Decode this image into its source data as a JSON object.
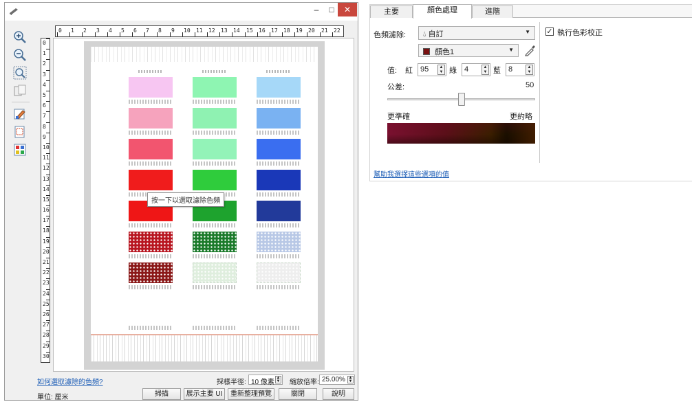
{
  "window": {
    "minimize_glyph": "–",
    "maximize_glyph": "□",
    "close_glyph": "✕"
  },
  "toolbar": {
    "icons": [
      "zoom-in-icon",
      "zoom-out-icon",
      "zoom-fit-icon",
      "page-fit-icon",
      "color-pick-icon",
      "select-region-icon",
      "color-grid-icon"
    ]
  },
  "ruler": {
    "horizontal": [
      "0",
      "1",
      "2",
      "3",
      "4",
      "5",
      "6",
      "7",
      "8",
      "9",
      "10",
      "11",
      "12",
      "13",
      "14",
      "15",
      "16",
      "17",
      "18",
      "19",
      "20",
      "21",
      "22"
    ],
    "vertical": [
      "0",
      "1",
      "2",
      "3",
      "4",
      "5",
      "6",
      "7",
      "8",
      "9",
      "10",
      "11",
      "12",
      "13",
      "14",
      "15",
      "16",
      "17",
      "18",
      "19",
      "20",
      "21",
      "22",
      "23",
      "24",
      "25",
      "26",
      "27",
      "28",
      "29",
      "30"
    ]
  },
  "preview": {
    "tooltip": "按一下以選取濾除色頻",
    "swatch_colors": [
      [
        "#f7c6f2",
        "#8ef5b2",
        "#a6d8f8"
      ],
      [
        "#f6a3bd",
        "#8ff2b2",
        "#7ab2f2"
      ],
      [
        "#f2556f",
        "#93f3b8",
        "#3a6ef0"
      ],
      [
        "#f01c1c",
        "#2fcc3c",
        "#1a38b8"
      ],
      [
        "#ef1616",
        "#1ea32e",
        "#223a9a"
      ],
      [
        "#b81520",
        "#1a7a2a",
        "#b8c8e6"
      ],
      [
        "#8a1818",
        "#dfeede",
        "#eeeeee"
      ]
    ]
  },
  "status": {
    "help_link": "如何選取濾除的色頻?",
    "radius_label": "採樣半徑:",
    "radius_value": "10 像素",
    "zoom_label": "縮放倍率:",
    "zoom_value": "25.00%",
    "unit_label": "單位: 厘米",
    "scan_btn": "掃描",
    "show_main_btn": "展示主要 UI",
    "refresh_btn": "重新整理預覽",
    "close_btn": "關閉",
    "help_btn": "說明"
  },
  "panel": {
    "tabs": [
      "主要",
      "顏色處理",
      "進階"
    ],
    "active_tab": "顏色處理",
    "color_dropout_label": "色頻濾除:",
    "dropout_mode": "自訂",
    "color_name": "顏色1",
    "color_swatch": "#7a1010",
    "values_label": "值:",
    "red_label": "紅",
    "red_value": "95",
    "green_label": "綠",
    "green_value": "4",
    "blue_label": "藍",
    "blue_value": "8",
    "tolerance_label": "公差:",
    "tolerance_value": "50",
    "tolerance_level": 0.5,
    "more_precise": "更準確",
    "more_rough": "更約略",
    "color_correction_label": "執行色彩校正",
    "color_correction_checked": true,
    "help_link": "幫助我選擇這些選項的值"
  }
}
